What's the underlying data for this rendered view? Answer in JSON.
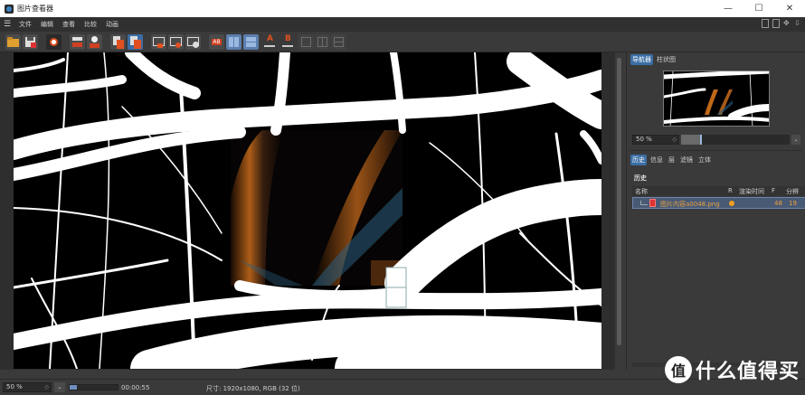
{
  "window": {
    "title": "图片查看器",
    "minimize": "—",
    "maximize": "☐",
    "close": "✕"
  },
  "menu": {
    "items": [
      "文件",
      "编辑",
      "查看",
      "比较",
      "动画"
    ]
  },
  "toolbar": {
    "icons": [
      "open-icon",
      "save-icon",
      "render-region-icon",
      "edit-icon",
      "user-icon",
      "copy-icon",
      "paste-icon",
      "view-a-icon",
      "view-b-icon",
      "view-c-icon",
      "ab-compare-icon",
      "split-icon",
      "swap-icon",
      "set-a-icon",
      "set-b-icon",
      "layout-1-icon",
      "layout-2-icon",
      "layout-3-icon"
    ],
    "set_a_label": "A",
    "set_b_label": "B",
    "ab_label": "AB"
  },
  "navigator": {
    "tabs": [
      "导航器",
      "柱状图"
    ],
    "active_tab": "导航器",
    "zoom_value": "50 %"
  },
  "history_panel": {
    "tabs": [
      "历史",
      "信息",
      "层",
      "滤镜",
      "立体"
    ],
    "active_tab": "历史",
    "section_title": "历史",
    "columns": [
      "名称",
      "R",
      "渲染时间",
      "F",
      "分辨"
    ],
    "rows": [
      {
        "name": "图片内容a0048.png",
        "frame": "48",
        "resolution": "19"
      }
    ]
  },
  "statusbar": {
    "zoom": "50 %",
    "time": "00:00:55",
    "info": "尺寸: 1920x1080, RGB (32 位)",
    "progress": 0.15
  },
  "watermark": {
    "badge": "值",
    "text": "什么值得买"
  },
  "colors": {
    "accent": "#3b6ea5",
    "orange": "#e8a040",
    "panel_bg": "#3a3a3a"
  }
}
